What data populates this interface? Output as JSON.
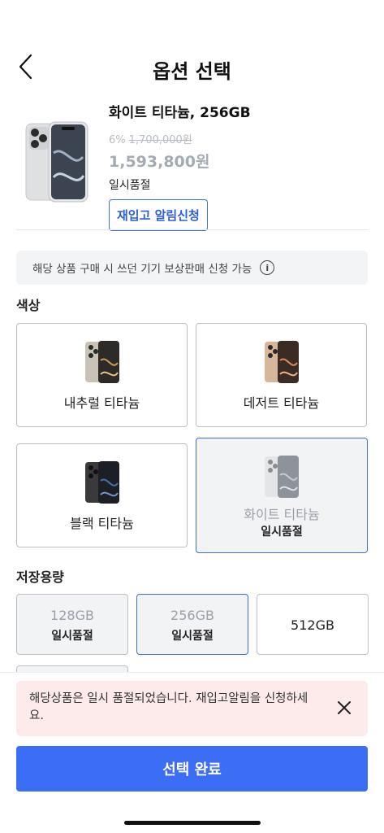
{
  "header": {
    "title": "옵션 선택"
  },
  "product": {
    "name": "화이트 티타늄, 256GB",
    "discount": "6%",
    "original_price": "1,700,000원",
    "sale_price": "1,593,800원",
    "stock_status": "일시품절",
    "restock_button": "재입고 알림신청"
  },
  "notice": {
    "text": "해당 상품 구매 시 쓰던 기기 보상판매 신청 가능",
    "icon": "info-icon"
  },
  "color_section": {
    "label": "색상",
    "options": [
      {
        "name": "내추럴 티타늄",
        "status": ""
      },
      {
        "name": "데저트 티타늄",
        "status": ""
      },
      {
        "name": "블랙 티타늄",
        "status": ""
      },
      {
        "name": "화이트 티타늄",
        "status": "일시품절"
      }
    ]
  },
  "storage_section": {
    "label": "저장용량",
    "options": [
      {
        "name": "128GB",
        "status": "일시품절"
      },
      {
        "name": "256GB",
        "status": "일시품절"
      },
      {
        "name": "512GB",
        "status": ""
      }
    ]
  },
  "toast": {
    "text": "해당상품은 일시 품절되었습니다. 재입고알림을 신청하세요.",
    "close_icon": "close-icon"
  },
  "footer": {
    "confirm_label": "선택 완료"
  },
  "colors": {
    "accent": "#3b6ef5",
    "selected_border": "#3d6fe0",
    "toast_bg": "#fcebea"
  }
}
